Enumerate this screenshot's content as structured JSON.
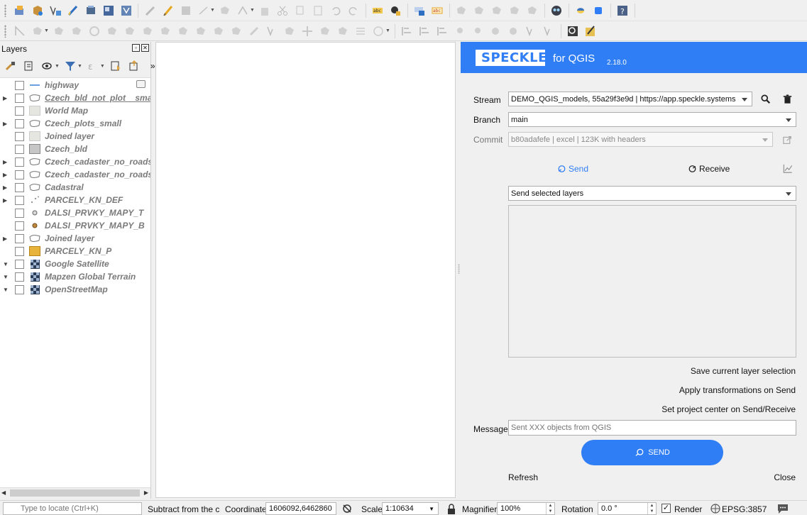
{
  "layers_panel": {
    "title": "Layers",
    "layers": [
      {
        "name": "highway",
        "symbol": "line-icon",
        "expandable": false,
        "underline": false
      },
      {
        "name": "Czech_bld_not_plot__small",
        "symbol": "polygon-icon",
        "expandable": true,
        "underline": true
      },
      {
        "name": "World Map",
        "symbol": "fill-swatch-icon",
        "expandable": false,
        "underline": false
      },
      {
        "name": "Czech_plots_small",
        "symbol": "polygon-icon",
        "expandable": true,
        "underline": false
      },
      {
        "name": "Joined layer",
        "symbol": "fill-swatch-icon",
        "expandable": false,
        "underline": false
      },
      {
        "name": "Czech_bld",
        "symbol": "grey-swatch-icon",
        "expandable": false,
        "underline": false
      },
      {
        "name": "Czech_cadaster_no_roads",
        "symbol": "polygon-icon",
        "expandable": true,
        "underline": false
      },
      {
        "name": "Czech_cadaster_no_roads c",
        "symbol": "polygon-icon",
        "expandable": true,
        "underline": false
      },
      {
        "name": "Cadastral",
        "symbol": "polygon-icon",
        "expandable": true,
        "underline": false
      },
      {
        "name": "PARCELY_KN_DEF",
        "symbol": "dots-icon",
        "expandable": true,
        "underline": false
      },
      {
        "name": "DALSI_PRVKY_MAPY_T",
        "symbol": "point-icon",
        "expandable": false,
        "underline": false
      },
      {
        "name": "DALSI_PRVKY_MAPY_B",
        "symbol": "point-brown-icon",
        "expandable": false,
        "underline": false
      },
      {
        "name": "Joined layer",
        "symbol": "polygon-icon",
        "expandable": true,
        "underline": false
      },
      {
        "name": "PARCELY_KN_P",
        "symbol": "orange-swatch-icon",
        "expandable": false,
        "underline": false
      },
      {
        "name": "Google Satellite",
        "symbol": "raster-icon",
        "expandable": true,
        "underline": false
      },
      {
        "name": "Mapzen Global Terrain",
        "symbol": "raster-icon",
        "expandable": true,
        "underline": false
      },
      {
        "name": "OpenStreetMap",
        "symbol": "raster-icon",
        "expandable": true,
        "underline": false
      }
    ]
  },
  "speckle": {
    "logo_text": "SPECKLE",
    "for_label": "for QGIS",
    "version": "2.18.0",
    "stream_label": "Stream",
    "stream_value": "DEMO_QGIS_models, 55a29f3e9d | https://app.speckle.systems",
    "branch_label": "Branch",
    "branch_value": "main",
    "commit_label": "Commit",
    "commit_value": "b80adafefe | excel | 123K with headers",
    "send_tab": "Send",
    "receive_tab": "Receive",
    "send_mode": "Send selected layers",
    "save_selection": "Save current layer selection",
    "apply_transformations": "Apply transformations on Send",
    "set_center": "Set project center on Send/Receive",
    "message_label": "Message",
    "message_placeholder": "Sent XXX objects from QGIS",
    "send_button": "SEND",
    "refresh": "Refresh",
    "close": "Close"
  },
  "statusbar": {
    "locate_placeholder": "Type to locate (Ctrl+K)",
    "subtract_text": "Subtract from the cur",
    "coordinate_label": "Coordinate",
    "coordinate_value": "1606092,6462860",
    "scale_label": "Scale",
    "scale_value": "1:10634",
    "magnifier_label": "Magnifier",
    "magnifier_value": "100%",
    "rotation_label": "Rotation",
    "rotation_value": "0.0 °",
    "render_label": "Render",
    "render_checked": true,
    "crs": "EPSG:3857"
  },
  "colors": {
    "speckle_blue": "#2f7ef5",
    "layer_text": "#7a7a7a",
    "orange_swatch": "#e8b33a"
  }
}
